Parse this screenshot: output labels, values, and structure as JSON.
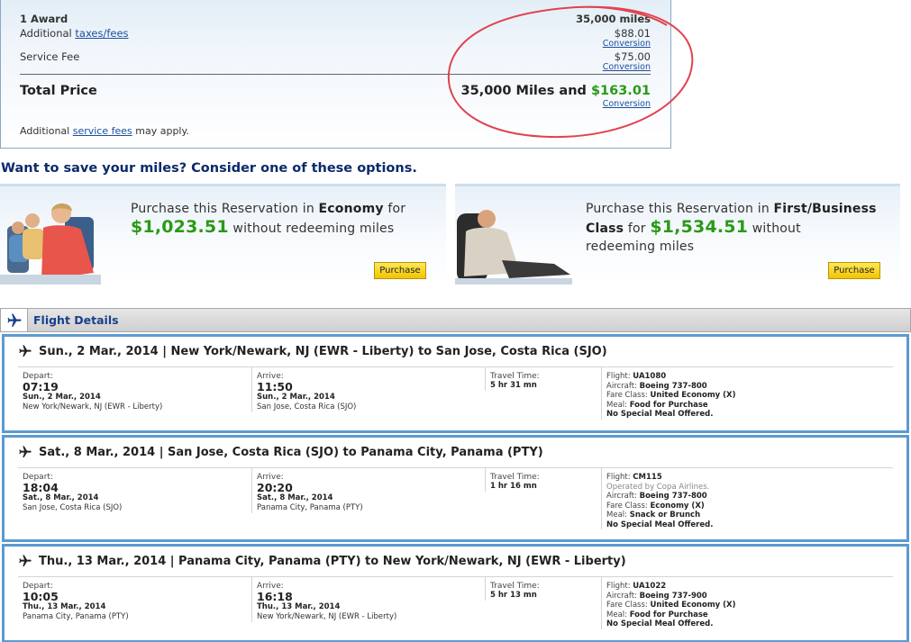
{
  "price_summary": {
    "award_label": "1 Award",
    "award_value": "35,000 miles",
    "taxes_prefix": "Additional ",
    "taxes_link": "taxes/fees",
    "taxes_value": "$88.01",
    "service_fee_label": "Service Fee",
    "service_fee_value": "$75.00",
    "conversion_link": "Conversion",
    "total_label": "Total Price",
    "total_miles": "35,000 Miles and ",
    "total_cash": "$163.01",
    "note_prefix": "Additional ",
    "note_link": "service fees",
    "note_suffix": " may apply."
  },
  "save_miles": {
    "heading": "Want to save your miles? Consider one of these options.",
    "economy": {
      "text_prefix": "Purchase this Reservation in ",
      "cabin": "Economy",
      "text_for": " for",
      "price": "$1,023.51",
      "text_suffix": " without redeeming miles",
      "button": "Purchase"
    },
    "business": {
      "text_prefix": "Purchase this Reservation in ",
      "cabin_line1": "First/Business",
      "cabin_line2": "Class",
      "text_for": " for ",
      "price": "$1,534.51",
      "text_suffix1": " without",
      "text_suffix2": "redeeming miles",
      "button": "Purchase"
    }
  },
  "flight_details": {
    "title": "Flight Details",
    "labels": {
      "depart": "Depart:",
      "arrive": "Arrive:",
      "travel_time": "Travel Time:",
      "flight": "Flight: ",
      "aircraft": "Aircraft: ",
      "fare_class": "Fare Class: ",
      "meal": "Meal: "
    },
    "segments": [
      {
        "header": "Sun., 2 Mar., 2014 | New York/Newark, NJ (EWR - Liberty) to San Jose, Costa Rica (SJO)",
        "depart_time": "07:19",
        "depart_date": "Sun., 2 Mar., 2014",
        "depart_city": "New York/Newark, NJ (EWR - Liberty)",
        "arrive_time": "11:50",
        "arrive_date": "Sun., 2 Mar., 2014",
        "arrive_city": "San Jose, Costa Rica (SJO)",
        "duration": "5 hr 31 mn",
        "flight": "UA1080",
        "operated_by": "",
        "aircraft": "Boeing 737-800",
        "fare_class": "United Economy (X)",
        "meal": "Food for Purchase",
        "special_meal": "No Special Meal Offered."
      },
      {
        "header": "Sat., 8 Mar., 2014 | San Jose, Costa Rica (SJO) to Panama City, Panama (PTY)",
        "depart_time": "18:04",
        "depart_date": "Sat., 8 Mar., 2014",
        "depart_city": "San Jose, Costa Rica (SJO)",
        "arrive_time": "20:20",
        "arrive_date": "Sat., 8 Mar., 2014",
        "arrive_city": "Panama City, Panama (PTY)",
        "duration": "1 hr 16 mn",
        "flight": "CM115",
        "operated_by": "Operated by Copa Airlines.",
        "aircraft": "Boeing 737-800",
        "fare_class": "Economy (X)",
        "meal": "Snack or Brunch",
        "special_meal": "No Special Meal Offered."
      },
      {
        "header": "Thu., 13 Mar., 2014 | Panama City, Panama (PTY) to New York/Newark, NJ (EWR - Liberty)",
        "depart_time": "10:05",
        "depart_date": "Thu., 13 Mar., 2014",
        "depart_city": "Panama City, Panama (PTY)",
        "arrive_time": "16:18",
        "arrive_date": "Thu., 13 Mar., 2014",
        "arrive_city": "New York/Newark, NJ (EWR - Liberty)",
        "duration": "5 hr 13 mn",
        "flight": "UA1022",
        "operated_by": "",
        "aircraft": "Boeing 737-900",
        "fare_class": "United Economy (X)",
        "meal": "Food for Purchase",
        "special_meal": "No Special Meal Offered."
      }
    ]
  },
  "colors": {
    "price_green": "#2a9a16",
    "link_blue": "#1a4f9c",
    "segment_border": "#5b9bd0",
    "annotation_red": "#e0434f"
  }
}
